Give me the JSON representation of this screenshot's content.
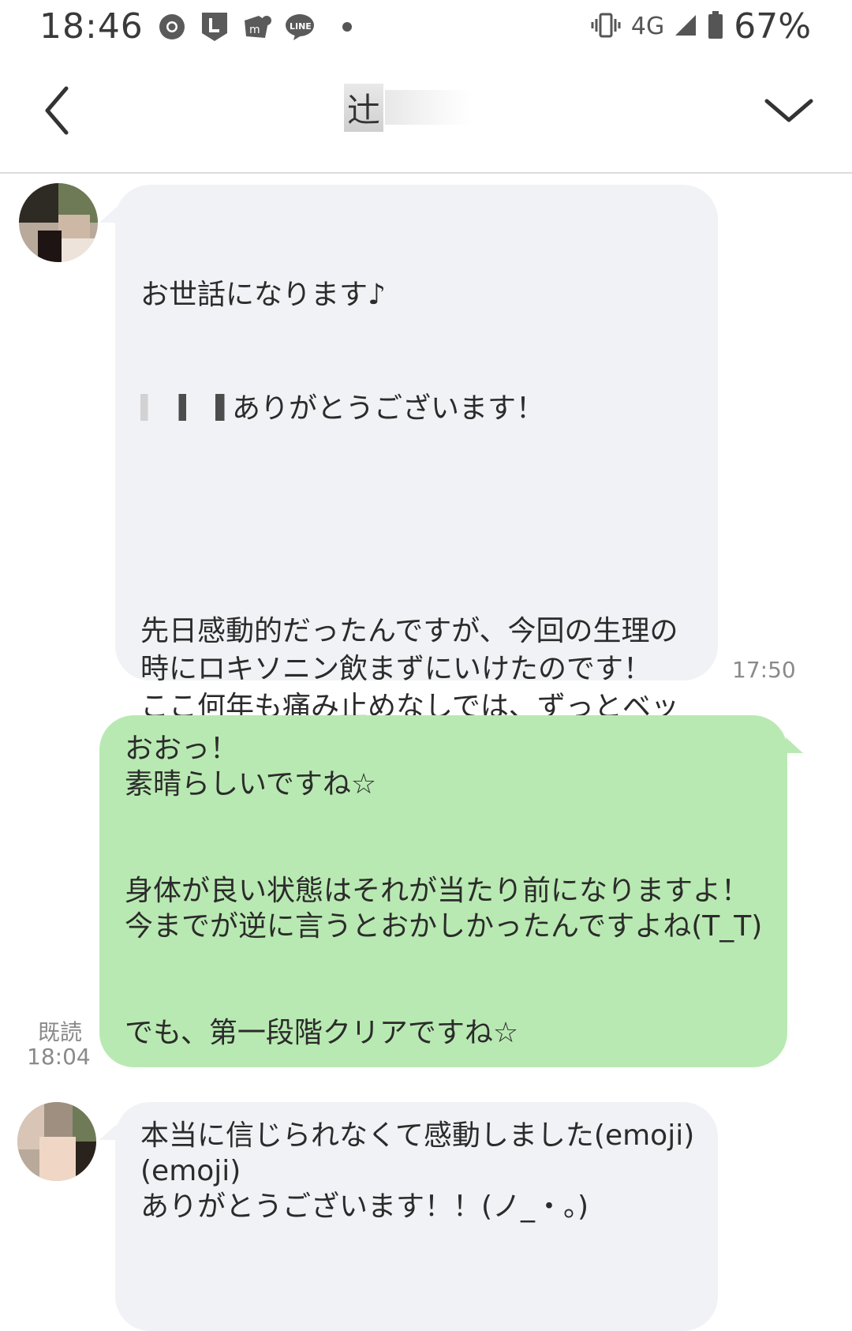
{
  "status_bar": {
    "time": "18:46",
    "network": "4G",
    "battery": "67%",
    "notification_icons": [
      "chrome-icon",
      "l-app-icon",
      "mercari-icon",
      "line-icon"
    ]
  },
  "header": {
    "title": "辻"
  },
  "messages": [
    {
      "direction": "incoming",
      "text": "お世話になります♪\n[redacted]ありがとうございます！\n\n先日感動的だったんですが、今回の生理の時にロキソニン飲まずにいけたのです！\nここ何年も痛み止めなしでは、ずっとベッドで丸まって冷や汗かいてたくらいなのに、今回試しに薬飲まずに過ごしてたら痛みが全くないわけではなかったのですが飲まずにいけました！！\nさらに漢方飲んだらもっと楽になりました！！\n感動です！！(emoji)(emoji)",
      "line1": "お世話になります♪",
      "line2_suffix": "ありがとうございます！",
      "body": "先日感動的だったんですが、今回の生理の\n時にロキソニン飲まずにいけたのです！\nここ何年も痛み止めなしでは、ずっとベッ\nドで丸まって冷や汗かいてたくらいなの\nに、今回試しに薬飲まずに過ごしてたら痛\nみが全くないわけではなかったのですが飲\nまずにいけました！！\nさらに漢方飲んだらもっと楽になりまし\nた！！\n感動です！！(emoji)(emoji)",
      "time": "17:50"
    },
    {
      "direction": "outgoing",
      "text": "おおっ！\n素晴らしいですね☆\n\n\n身体が良い状態はそれが当たり前になりますよ！\n今までが逆に言うとおかしかったんですよね(T_T)\n\n\nでも、第一段階クリアですね☆",
      "read_label": "既読",
      "time": "18:04"
    },
    {
      "direction": "incoming",
      "text": "本当に信じられなくて感動しました(emoji)\n(emoji)\nありがとうございます！！(ノ_・。)"
    }
  ]
}
